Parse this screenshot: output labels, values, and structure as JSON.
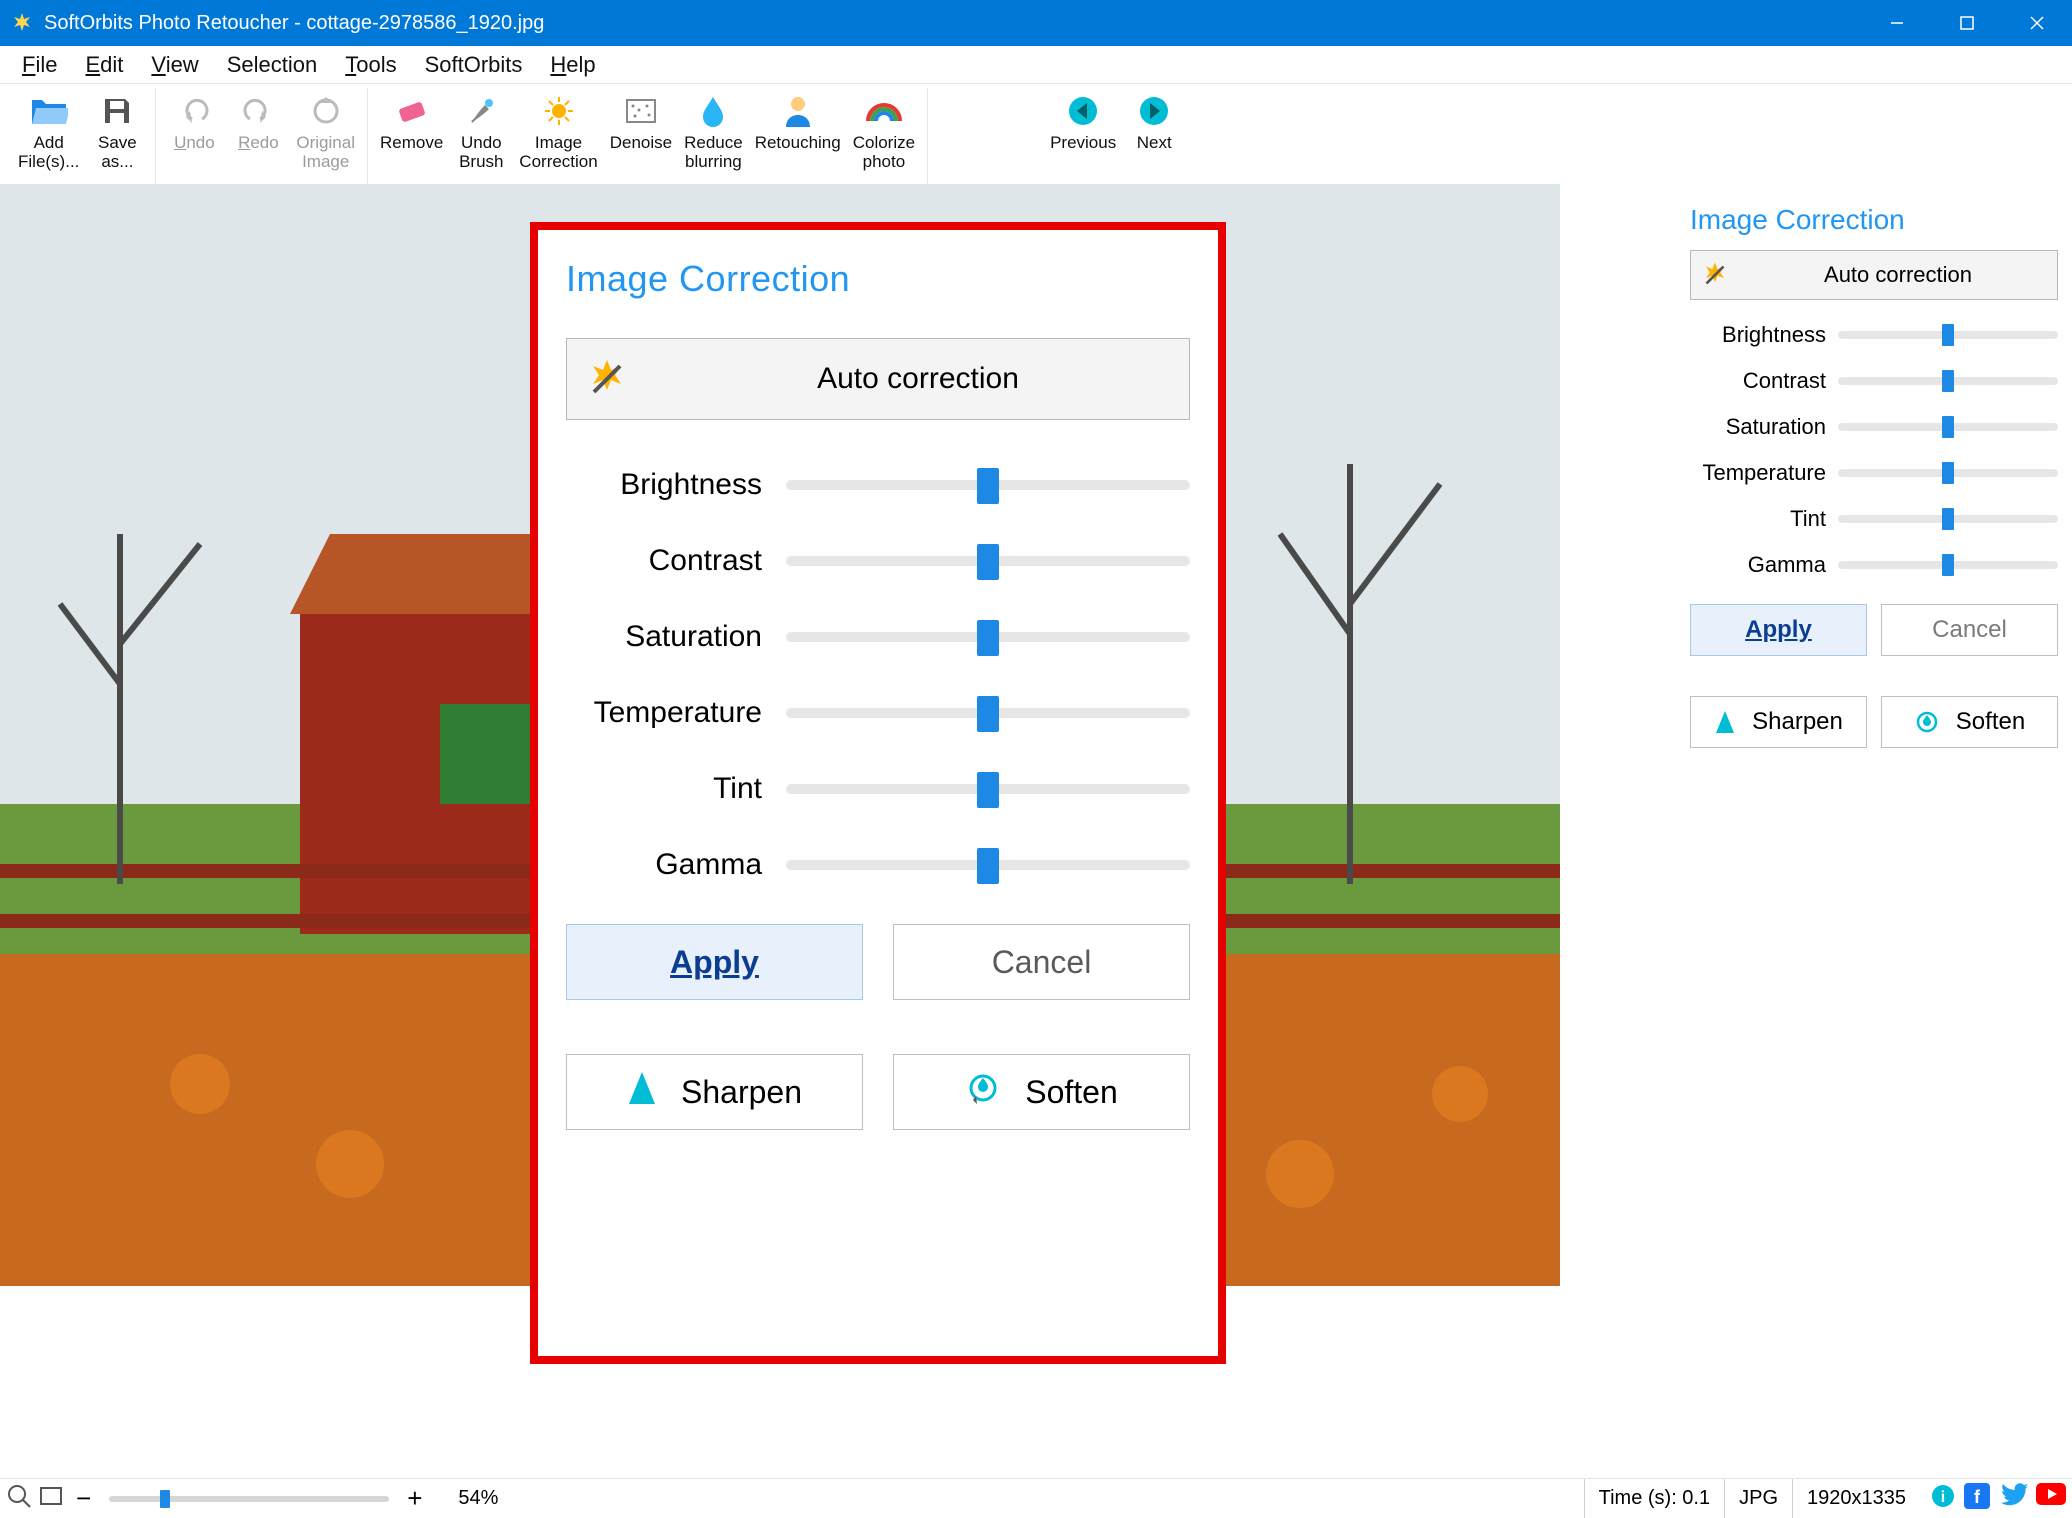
{
  "title": "SoftOrbits Photo Retoucher - cottage-2978586_1920.jpg",
  "menu": {
    "file": "File",
    "edit": "Edit",
    "view": "View",
    "selection": "Selection",
    "tools": "Tools",
    "softorbits": "SoftOrbits",
    "help": "Help"
  },
  "toolbar": {
    "add_files": "Add\nFile(s)...",
    "save_as": "Save\nas...",
    "undo": "Undo",
    "redo": "Redo",
    "original_image": "Original\nImage",
    "remove": "Remove",
    "undo_brush": "Undo\nBrush",
    "image_correction": "Image\nCorrection",
    "denoise": "Denoise",
    "reduce_blurring": "Reduce\nblurring",
    "retouching": "Retouching",
    "colorize_photo": "Colorize\nphoto",
    "previous": "Previous",
    "next": "Next"
  },
  "panel": {
    "title": "Image Correction",
    "auto": "Auto correction",
    "sliders": {
      "brightness": "Brightness",
      "contrast": "Contrast",
      "saturation": "Saturation",
      "temperature": "Temperature",
      "tint": "Tint",
      "gamma": "Gamma"
    },
    "apply": "Apply",
    "cancel": "Cancel",
    "sharpen": "Sharpen",
    "soften": "Soften"
  },
  "dialog": {
    "title": "Image Correction",
    "auto": "Auto correction",
    "sliders": {
      "brightness": "Brightness",
      "contrast": "Contrast",
      "saturation": "Saturation",
      "temperature": "Temperature",
      "tint": "Tint",
      "gamma": "Gamma"
    },
    "apply": "Apply",
    "cancel": "Cancel",
    "sharpen": "Sharpen",
    "soften": "Soften"
  },
  "status": {
    "zoom": "54%",
    "time": "Time (s): 0.1",
    "format": "JPG",
    "dims": "1920x1335"
  }
}
